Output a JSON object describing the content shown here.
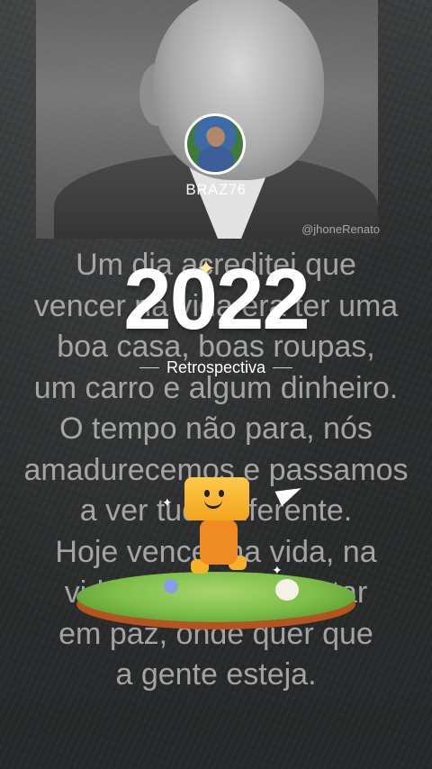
{
  "post": {
    "username": "BRAZ76",
    "watermark": "@jhoneRenato"
  },
  "poem_lines": [
    "Um dia acreditei que",
    "vencer na vida era ter uma",
    "boa casa, boas roupas,",
    "um carro e algum dinheiro.",
    "O tempo não para, nós",
    "amadurecemos e passamos",
    "a ver tudo diferente.",
    "Hoje vencer na vida, na",
    "vida é sobretudo estar",
    "em paz, onde quer que",
    "a gente esteja."
  ],
  "title": {
    "year": "2022",
    "subtitle": "Retrospectiva"
  },
  "icons": {
    "sparkle": "sparkle-icon",
    "paper_plane": "paper-plane-icon"
  },
  "colors": {
    "background": "#2a2c2d",
    "title_text": "#ffffff",
    "robot_orange": "#f08a23",
    "grass": "#7fbf4a"
  }
}
